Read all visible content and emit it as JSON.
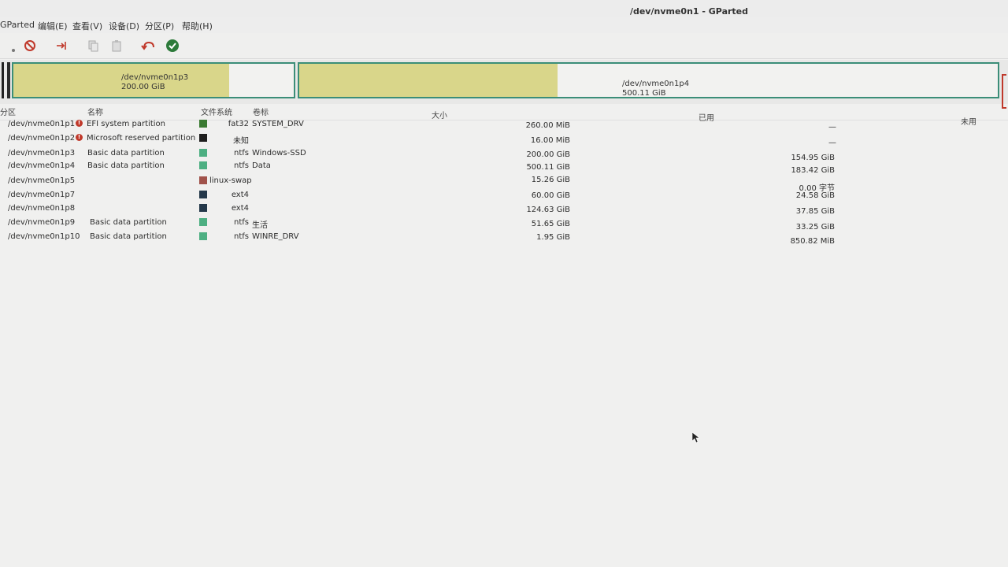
{
  "window": {
    "title": "/dev/nvme0n1 - GParted"
  },
  "menu": [
    "GParted",
    "编辑(E)",
    "查看(V)",
    "设备(D)",
    "分区(P)",
    "帮助(H)"
  ],
  "toolbar": {
    "new_icon": "new-icon",
    "delete_icon": "delete-icon",
    "resize_icon": "resize-icon",
    "copy_icon": "copy-icon",
    "paste_icon": "paste-icon",
    "undo_icon": "undo-icon",
    "apply_icon": "apply-icon"
  },
  "diskmap": [
    {
      "name": "/dev/nvme0n1p3",
      "size": "200.00 GiB",
      "used_fraction": 0.77
    },
    {
      "name": "/dev/nvme0n1p4",
      "size": "500.11 GiB",
      "used_fraction": 0.37
    }
  ],
  "columns": {
    "partition": "分区",
    "name": "名称",
    "filesystem": "文件系统",
    "label": "卷标",
    "size": "大小",
    "used": "已用",
    "unused": "未用"
  },
  "rows": [
    {
      "partition": "/dev/nvme0n1p1",
      "warning": true,
      "name": "EFI system partition",
      "fs_color": "#3a7a32",
      "filesystem": "fat32",
      "label": "SYSTEM_DRV",
      "size": "260.00 MiB",
      "used": "—"
    },
    {
      "partition": "/dev/nvme0n1p2",
      "warning": true,
      "name": "Microsoft reserved partition",
      "fs_color": "#1e1e1e",
      "filesystem": "未知",
      "label": "",
      "size": "16.00 MiB",
      "used": "—"
    },
    {
      "partition": "/dev/nvme0n1p3",
      "warning": false,
      "name": "Basic data partition",
      "fs_color": "#4daf82",
      "filesystem": "ntfs",
      "label": "Windows-SSD",
      "size": "200.00 GiB",
      "used": "154.95 GiB"
    },
    {
      "partition": "/dev/nvme0n1p4",
      "warning": false,
      "name": "Basic data partition",
      "fs_color": "#4daf82",
      "filesystem": "ntfs",
      "label": "Data",
      "size": "500.11 GiB",
      "used": "183.42 GiB"
    },
    {
      "partition": "/dev/nvme0n1p5",
      "warning": false,
      "name": "",
      "fs_color": "#a0524a",
      "filesystem": "linux-swap",
      "label": "",
      "size": "15.26 GiB",
      "used": "0.00 字节"
    },
    {
      "partition": "/dev/nvme0n1p7",
      "warning": false,
      "name": "",
      "fs_color": "#24384a",
      "filesystem": "ext4",
      "label": "",
      "size": "60.00 GiB",
      "used": "24.58 GiB"
    },
    {
      "partition": "/dev/nvme0n1p8",
      "warning": false,
      "name": "",
      "fs_color": "#24384a",
      "filesystem": "ext4",
      "label": "",
      "size": "124.63 GiB",
      "used": "37.85 GiB"
    },
    {
      "partition": "/dev/nvme0n1p9",
      "warning": false,
      "name": "Basic data partition",
      "fs_color": "#4daf82",
      "filesystem": "ntfs",
      "label": "生活",
      "size": "51.65 GiB",
      "used": "33.25 GiB"
    },
    {
      "partition": "/dev/nvme0n1p10",
      "warning": false,
      "name": "Basic data partition",
      "fs_color": "#4daf82",
      "filesystem": "ntfs",
      "label": "WINRE_DRV",
      "size": "1.95 GiB",
      "used": "850.82 MiB"
    }
  ]
}
